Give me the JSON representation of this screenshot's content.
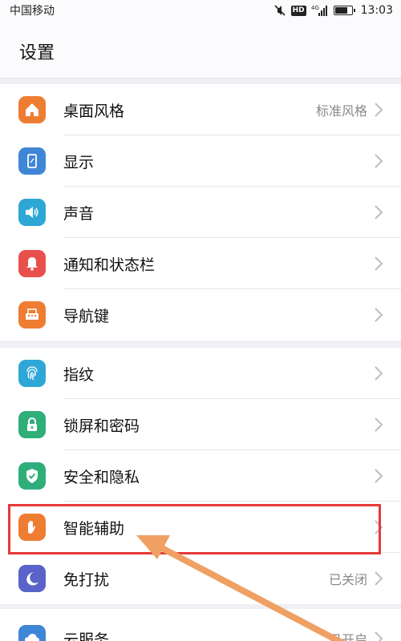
{
  "status_bar": {
    "carrier": "中国移动",
    "network_badge": "HD",
    "network_type": "4G",
    "time": "13:03"
  },
  "header": {
    "title": "设置"
  },
  "settings": {
    "group1": [
      {
        "label": "桌面风格",
        "value": "标准风格",
        "icon": "home-icon",
        "color": "#ee7d32"
      },
      {
        "label": "显示",
        "value": "",
        "icon": "display-icon",
        "color": "#3f86d6"
      },
      {
        "label": "声音",
        "value": "",
        "icon": "speaker-icon",
        "color": "#2fa7d6"
      },
      {
        "label": "通知和状态栏",
        "value": "",
        "icon": "bell-icon",
        "color": "#e9504c"
      },
      {
        "label": "导航键",
        "value": "",
        "icon": "navigation-key-icon",
        "color": "#ee7d32"
      }
    ],
    "group2": [
      {
        "label": "指纹",
        "value": "",
        "icon": "fingerprint-icon",
        "color": "#2fa7d6"
      },
      {
        "label": "锁屏和密码",
        "value": "",
        "icon": "lock-icon",
        "color": "#2fae7a"
      },
      {
        "label": "安全和隐私",
        "value": "",
        "icon": "shield-check-icon",
        "color": "#2fae7a"
      },
      {
        "label": "智能辅助",
        "value": "",
        "icon": "hand-icon",
        "color": "#ee7d32"
      },
      {
        "label": "免打扰",
        "value": "已关闭",
        "icon": "moon-icon",
        "color": "#5a63c9"
      },
      {
        "label": "云服务",
        "value": "已开启",
        "icon": "cloud-icon",
        "color": "#3f86d6"
      }
    ]
  },
  "annotation": {
    "highlight_color": "#e53a3a",
    "arrow_color": "#f0a063"
  }
}
